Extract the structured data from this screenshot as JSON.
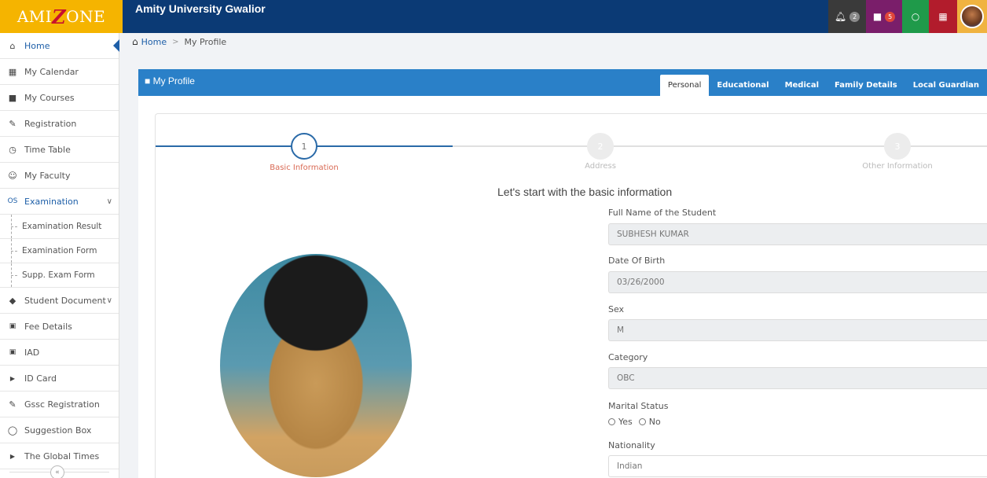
{
  "brand": {
    "logo_text_before": "AMI",
    "logo_text_z": "Z",
    "logo_text_after": "ONE"
  },
  "header": {
    "title": "Amity University Gwalior",
    "notification_count": "2",
    "book_count": "5"
  },
  "sidebar": {
    "items": [
      {
        "label": "Home",
        "icon": "home-icon"
      },
      {
        "label": "My Calendar",
        "icon": "calendar-icon"
      },
      {
        "label": "My Courses",
        "icon": "book-icon"
      },
      {
        "label": "Registration",
        "icon": "edit-icon"
      },
      {
        "label": "Time Table",
        "icon": "clock-icon"
      },
      {
        "label": "My Faculty",
        "icon": "users-icon"
      },
      {
        "label": "Examination",
        "icon": "exam-icon"
      },
      {
        "label": "Examination Result"
      },
      {
        "label": "Examination Form"
      },
      {
        "label": "Supp. Exam Form"
      },
      {
        "label": "Student Document",
        "icon": "tag-icon"
      },
      {
        "label": "Fee Details",
        "icon": "money-icon"
      },
      {
        "label": "IAD",
        "icon": "money-icon"
      },
      {
        "label": "ID Card",
        "icon": "caret-right-icon"
      },
      {
        "label": "Gssc Registration",
        "icon": "edit-icon"
      },
      {
        "label": "Suggestion Box",
        "icon": "comment-icon"
      },
      {
        "label": "The Global Times",
        "icon": "caret-right-icon"
      }
    ],
    "collapse_label": "«"
  },
  "breadcrumb": {
    "home": "Home",
    "separator": ">",
    "current": "My Profile"
  },
  "profile": {
    "title": "My Profile",
    "tabs": [
      "Personal",
      "Educational",
      "Medical",
      "Family Details",
      "Local Guardian"
    ],
    "active_tab": "Personal",
    "steps": [
      {
        "number": "1",
        "label": "Basic Information",
        "state": "active"
      },
      {
        "number": "2",
        "label": "Address",
        "state": "pending"
      },
      {
        "number": "3",
        "label": "Other Information",
        "state": "pending"
      }
    ],
    "heading": "Let's start with the basic information",
    "fields": {
      "full_name_label": "Full Name of the Student",
      "full_name_value": "SUBHESH KUMAR",
      "dob_label": "Date Of Birth",
      "dob_value": "03/26/2000",
      "sex_label": "Sex",
      "sex_value": "M",
      "category_label": "Category",
      "category_value": "OBC",
      "marital_label": "Marital Status",
      "marital_yes": "Yes",
      "marital_no": "No",
      "nationality_label": "Nationality",
      "nationality_value": "Indian"
    }
  },
  "colors": {
    "header_bg": "#0b3a75",
    "logo_bg": "#f5b400",
    "panel_header": "#2a80c8",
    "active_step": "#2a6aa8",
    "active_step_label": "#d96a55"
  }
}
